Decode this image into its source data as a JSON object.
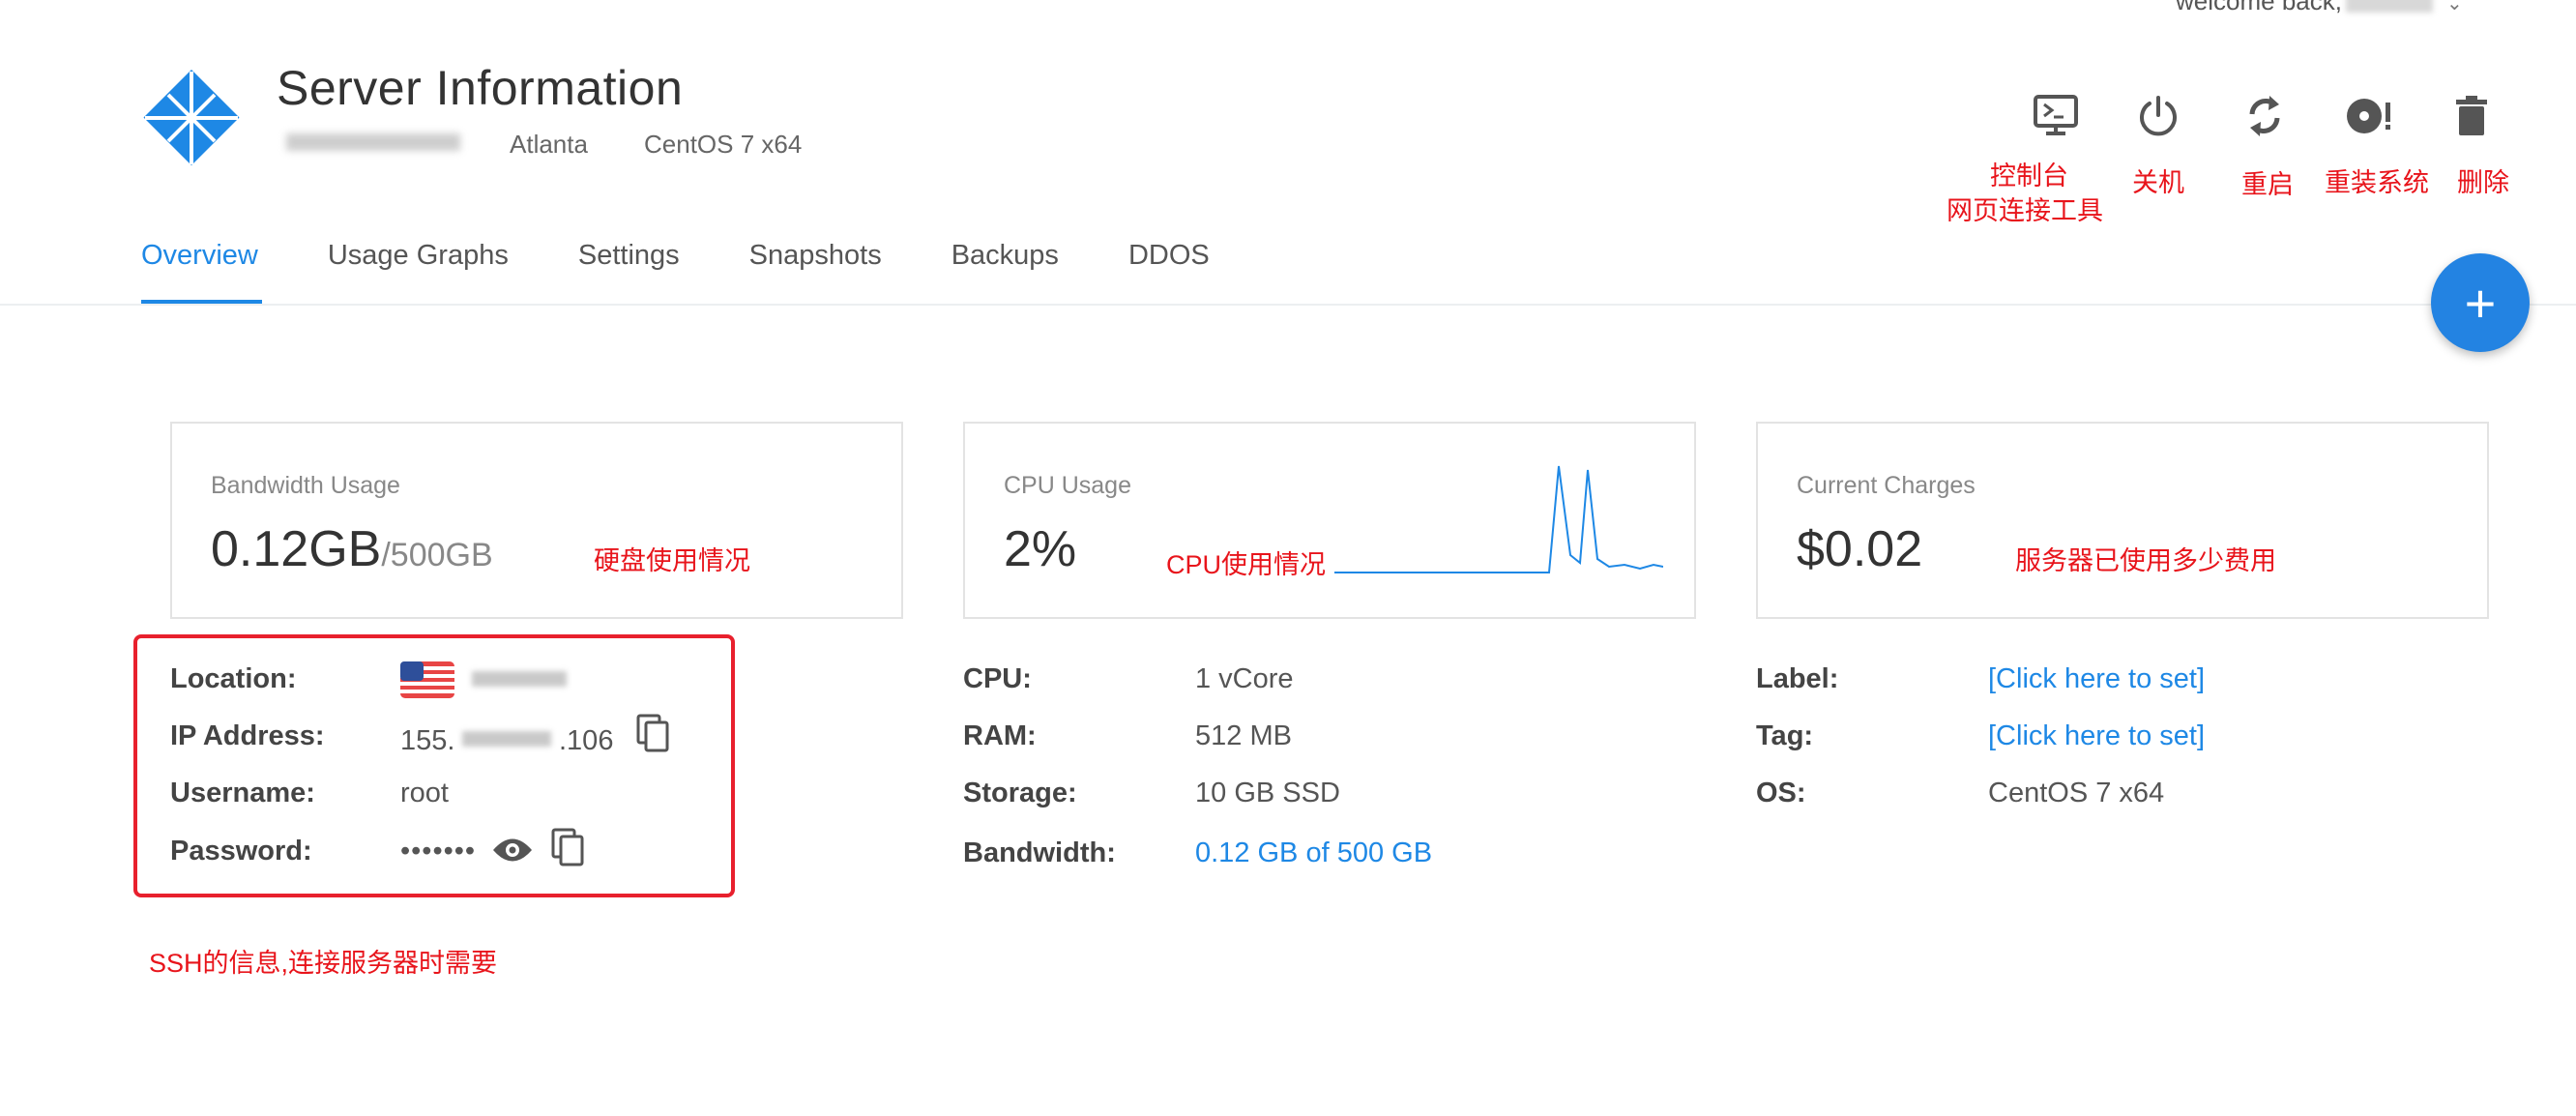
{
  "header": {
    "welcome": "welcome back,",
    "title": "Server Information",
    "location": "Atlanta",
    "os": "CentOS 7 x64"
  },
  "actions": [
    {
      "icon": "console-icon",
      "annotation_line1": "控制台",
      "annotation_line2": "网页连接工具"
    },
    {
      "icon": "power-icon",
      "annotation": "关机"
    },
    {
      "icon": "restart-icon",
      "annotation": "重启"
    },
    {
      "icon": "reinstall-icon",
      "annotation": "重装系统"
    },
    {
      "icon": "trash-icon",
      "annotation": "删除"
    }
  ],
  "tabs": [
    "Overview",
    "Usage Graphs",
    "Settings",
    "Snapshots",
    "Backups",
    "DDOS"
  ],
  "active_tab": "Overview",
  "fab": "+",
  "cards": {
    "bandwidth": {
      "label": "Bandwidth Usage",
      "value": "0.12GB",
      "total": "/500GB",
      "annotation": "硬盘使用情况"
    },
    "cpu": {
      "label": "CPU Usage",
      "value": "2%",
      "annotation": "CPU使用情况"
    },
    "charges": {
      "label": "Current Charges",
      "value": "$0.02",
      "annotation": "服务器已使用多少费用"
    }
  },
  "ssh": {
    "location_label": "Location:",
    "ip_label": "IP Address:",
    "ip_prefix": "155.",
    "ip_suffix": ".106",
    "username_label": "Username:",
    "username": "root",
    "password_label": "Password:",
    "password_mask": "•••••••",
    "annotation": "SSH的信息,连接服务器时需要"
  },
  "specs": {
    "cpu_label": "CPU:",
    "cpu": "1 vCore",
    "ram_label": "RAM:",
    "ram": "512 MB",
    "storage_label": "Storage:",
    "storage": "10 GB SSD",
    "bandwidth_label": "Bandwidth:",
    "bandwidth": "0.12 GB of 500 GB"
  },
  "meta": {
    "label_label": "Label:",
    "label": "[Click here to set]",
    "tag_label": "Tag:",
    "tag": "[Click here to set]",
    "os_label": "OS:",
    "os": "CentOS 7 x64"
  },
  "colors": {
    "accent": "#1e88e5",
    "annotation": "#e8141b",
    "fab": "#2383e2"
  }
}
